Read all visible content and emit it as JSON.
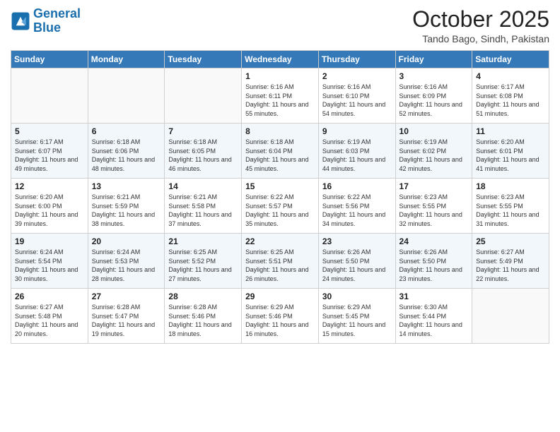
{
  "logo": {
    "text_general": "General",
    "text_blue": "Blue"
  },
  "header": {
    "month": "October 2025",
    "location": "Tando Bago, Sindh, Pakistan"
  },
  "weekdays": [
    "Sunday",
    "Monday",
    "Tuesday",
    "Wednesday",
    "Thursday",
    "Friday",
    "Saturday"
  ],
  "weeks": [
    [
      {
        "day": "",
        "sunrise": "",
        "sunset": "",
        "daylight": ""
      },
      {
        "day": "",
        "sunrise": "",
        "sunset": "",
        "daylight": ""
      },
      {
        "day": "",
        "sunrise": "",
        "sunset": "",
        "daylight": ""
      },
      {
        "day": "1",
        "sunrise": "Sunrise: 6:16 AM",
        "sunset": "Sunset: 6:11 PM",
        "daylight": "Daylight: 11 hours and 55 minutes."
      },
      {
        "day": "2",
        "sunrise": "Sunrise: 6:16 AM",
        "sunset": "Sunset: 6:10 PM",
        "daylight": "Daylight: 11 hours and 54 minutes."
      },
      {
        "day": "3",
        "sunrise": "Sunrise: 6:16 AM",
        "sunset": "Sunset: 6:09 PM",
        "daylight": "Daylight: 11 hours and 52 minutes."
      },
      {
        "day": "4",
        "sunrise": "Sunrise: 6:17 AM",
        "sunset": "Sunset: 6:08 PM",
        "daylight": "Daylight: 11 hours and 51 minutes."
      }
    ],
    [
      {
        "day": "5",
        "sunrise": "Sunrise: 6:17 AM",
        "sunset": "Sunset: 6:07 PM",
        "daylight": "Daylight: 11 hours and 49 minutes."
      },
      {
        "day": "6",
        "sunrise": "Sunrise: 6:18 AM",
        "sunset": "Sunset: 6:06 PM",
        "daylight": "Daylight: 11 hours and 48 minutes."
      },
      {
        "day": "7",
        "sunrise": "Sunrise: 6:18 AM",
        "sunset": "Sunset: 6:05 PM",
        "daylight": "Daylight: 11 hours and 46 minutes."
      },
      {
        "day": "8",
        "sunrise": "Sunrise: 6:18 AM",
        "sunset": "Sunset: 6:04 PM",
        "daylight": "Daylight: 11 hours and 45 minutes."
      },
      {
        "day": "9",
        "sunrise": "Sunrise: 6:19 AM",
        "sunset": "Sunset: 6:03 PM",
        "daylight": "Daylight: 11 hours and 44 minutes."
      },
      {
        "day": "10",
        "sunrise": "Sunrise: 6:19 AM",
        "sunset": "Sunset: 6:02 PM",
        "daylight": "Daylight: 11 hours and 42 minutes."
      },
      {
        "day": "11",
        "sunrise": "Sunrise: 6:20 AM",
        "sunset": "Sunset: 6:01 PM",
        "daylight": "Daylight: 11 hours and 41 minutes."
      }
    ],
    [
      {
        "day": "12",
        "sunrise": "Sunrise: 6:20 AM",
        "sunset": "Sunset: 6:00 PM",
        "daylight": "Daylight: 11 hours and 39 minutes."
      },
      {
        "day": "13",
        "sunrise": "Sunrise: 6:21 AM",
        "sunset": "Sunset: 5:59 PM",
        "daylight": "Daylight: 11 hours and 38 minutes."
      },
      {
        "day": "14",
        "sunrise": "Sunrise: 6:21 AM",
        "sunset": "Sunset: 5:58 PM",
        "daylight": "Daylight: 11 hours and 37 minutes."
      },
      {
        "day": "15",
        "sunrise": "Sunrise: 6:22 AM",
        "sunset": "Sunset: 5:57 PM",
        "daylight": "Daylight: 11 hours and 35 minutes."
      },
      {
        "day": "16",
        "sunrise": "Sunrise: 6:22 AM",
        "sunset": "Sunset: 5:56 PM",
        "daylight": "Daylight: 11 hours and 34 minutes."
      },
      {
        "day": "17",
        "sunrise": "Sunrise: 6:23 AM",
        "sunset": "Sunset: 5:55 PM",
        "daylight": "Daylight: 11 hours and 32 minutes."
      },
      {
        "day": "18",
        "sunrise": "Sunrise: 6:23 AM",
        "sunset": "Sunset: 5:55 PM",
        "daylight": "Daylight: 11 hours and 31 minutes."
      }
    ],
    [
      {
        "day": "19",
        "sunrise": "Sunrise: 6:24 AM",
        "sunset": "Sunset: 5:54 PM",
        "daylight": "Daylight: 11 hours and 30 minutes."
      },
      {
        "day": "20",
        "sunrise": "Sunrise: 6:24 AM",
        "sunset": "Sunset: 5:53 PM",
        "daylight": "Daylight: 11 hours and 28 minutes."
      },
      {
        "day": "21",
        "sunrise": "Sunrise: 6:25 AM",
        "sunset": "Sunset: 5:52 PM",
        "daylight": "Daylight: 11 hours and 27 minutes."
      },
      {
        "day": "22",
        "sunrise": "Sunrise: 6:25 AM",
        "sunset": "Sunset: 5:51 PM",
        "daylight": "Daylight: 11 hours and 26 minutes."
      },
      {
        "day": "23",
        "sunrise": "Sunrise: 6:26 AM",
        "sunset": "Sunset: 5:50 PM",
        "daylight": "Daylight: 11 hours and 24 minutes."
      },
      {
        "day": "24",
        "sunrise": "Sunrise: 6:26 AM",
        "sunset": "Sunset: 5:50 PM",
        "daylight": "Daylight: 11 hours and 23 minutes."
      },
      {
        "day": "25",
        "sunrise": "Sunrise: 6:27 AM",
        "sunset": "Sunset: 5:49 PM",
        "daylight": "Daylight: 11 hours and 22 minutes."
      }
    ],
    [
      {
        "day": "26",
        "sunrise": "Sunrise: 6:27 AM",
        "sunset": "Sunset: 5:48 PM",
        "daylight": "Daylight: 11 hours and 20 minutes."
      },
      {
        "day": "27",
        "sunrise": "Sunrise: 6:28 AM",
        "sunset": "Sunset: 5:47 PM",
        "daylight": "Daylight: 11 hours and 19 minutes."
      },
      {
        "day": "28",
        "sunrise": "Sunrise: 6:28 AM",
        "sunset": "Sunset: 5:46 PM",
        "daylight": "Daylight: 11 hours and 18 minutes."
      },
      {
        "day": "29",
        "sunrise": "Sunrise: 6:29 AM",
        "sunset": "Sunset: 5:46 PM",
        "daylight": "Daylight: 11 hours and 16 minutes."
      },
      {
        "day": "30",
        "sunrise": "Sunrise: 6:29 AM",
        "sunset": "Sunset: 5:45 PM",
        "daylight": "Daylight: 11 hours and 15 minutes."
      },
      {
        "day": "31",
        "sunrise": "Sunrise: 6:30 AM",
        "sunset": "Sunset: 5:44 PM",
        "daylight": "Daylight: 11 hours and 14 minutes."
      },
      {
        "day": "",
        "sunrise": "",
        "sunset": "",
        "daylight": ""
      }
    ]
  ]
}
